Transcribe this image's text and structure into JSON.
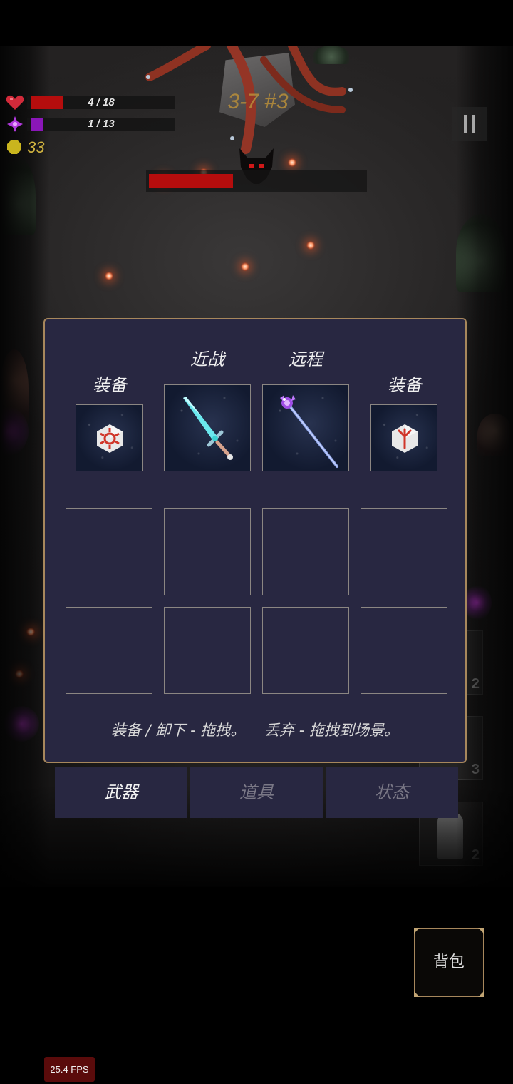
{
  "hud": {
    "health": {
      "text": "4 / 18",
      "current": 4,
      "max": 18,
      "color": "#b50d0d"
    },
    "mana": {
      "text": "1 / 13",
      "current": 1,
      "max": 13,
      "color": "#8a16b8"
    },
    "gold": "33",
    "stage": "3-7 #3",
    "boss_health_fraction": 0.39
  },
  "inventory": {
    "headers": {
      "equip_left": "装备",
      "melee": "近战",
      "ranged": "远程",
      "equip_right": "装备"
    },
    "equipped": {
      "left_item": "gear-rune-icon",
      "melee_item": "cyan-sword-icon",
      "ranged_item": "purple-staff-icon",
      "right_item": "tree-rune-icon"
    },
    "backpack_slots": 8,
    "hint": "装备 / 卸下 - 拖拽。    丢弃 - 拖拽到场景。"
  },
  "tabs": [
    {
      "label": "武器",
      "active": true
    },
    {
      "label": "道具",
      "active": false
    },
    {
      "label": "状态",
      "active": false
    }
  ],
  "background_slot_counts": [
    "2",
    "3",
    "2"
  ],
  "backpack_button": "背包",
  "fps": "25.4 FPS",
  "colors": {
    "panel_bg": "#282741",
    "panel_border": "#a7875c",
    "gold": "#d0b340",
    "stage_text": "#b98f3a"
  }
}
